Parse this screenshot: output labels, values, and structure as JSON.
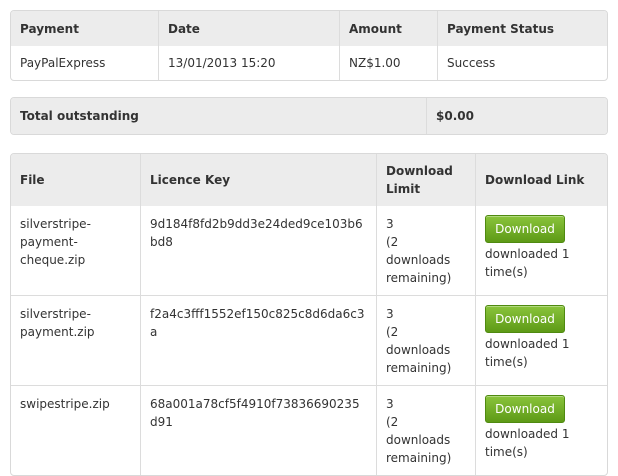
{
  "payments": {
    "headers": [
      "Payment",
      "Date",
      "Amount",
      "Payment Status"
    ],
    "rows": [
      [
        "PayPalExpress",
        "13/01/2013 15:20",
        "NZ$1.00",
        "Success"
      ]
    ]
  },
  "total": {
    "label": "Total outstanding",
    "value": "$0.00"
  },
  "downloads": {
    "headers": [
      "File",
      "Licence Key",
      "Download Limit",
      "Download Link"
    ],
    "button_label": "Download",
    "rows": [
      {
        "file": "silverstripe-payment-cheque.zip",
        "key": "9d184f8fd2b9dd3e24ded9ce103b6bd8",
        "limit": "3",
        "remaining": "(2 downloads remaining)",
        "downloaded": "downloaded 1 time(s)"
      },
      {
        "file": "silverstripe-payment.zip",
        "key": "f2a4c3fff1552ef150c825c8d6da6c3a",
        "limit": "3",
        "remaining": "(2 downloads remaining)",
        "downloaded": "downloaded 1 time(s)"
      },
      {
        "file": "swipestripe.zip",
        "key": "68a001a78cf5f4910f73836690235d91",
        "limit": "3",
        "remaining": "(2 downloads remaining)",
        "downloaded": "downloaded 1 time(s)"
      }
    ]
  },
  "colors": {
    "header_bg": "#ececec",
    "border": "#d9d9d9",
    "button_green": "#6aaa1e",
    "text": "#333333"
  }
}
